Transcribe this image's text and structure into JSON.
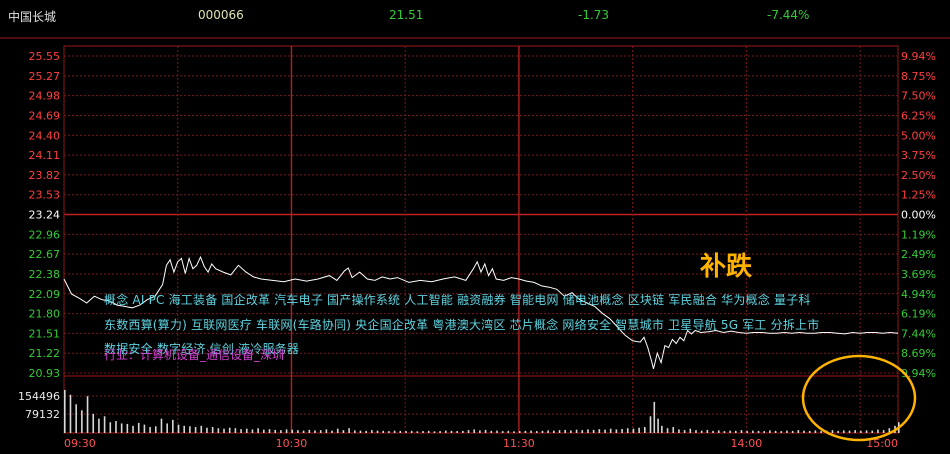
{
  "header": {
    "name": "中国长城",
    "code": "000066",
    "price": "21.51",
    "change": "-1.73",
    "pct": "-7.44%"
  },
  "colors": {
    "background": "#000000",
    "grid": "#7a1a1a",
    "axis": "#a01818",
    "up": "#ff4040",
    "down": "#33cc33",
    "neutral": "#ffffff",
    "price_line": "#ffffff",
    "volume": "#d8d8d8",
    "concept_text": "#5fd3e0",
    "sector_text": "#d040d0",
    "annotation": "#ffb300"
  },
  "concepts": {
    "line1": "概念  AI PC  海工装备  国企改革  汽车电子  国产操作系统  人工智能  融资融券  智能电网  储电池概念  区块链  军民融合  华为概念  量子科",
    "line2": "东数西算(算力)  互联网医疗  车联网(车路协同)  央企国企改革  粤港澳大湾区  芯片概念  网络安全  智慧城市  卫星导航  5G  军工  分拆上市",
    "line3": "数据安全  数字经济  信创  液冷服务器",
    "sector": "行业：计算机设备_通信设备_深圳"
  },
  "annotation": "补跌",
  "chart_data": {
    "type": "line",
    "title": "中国长城 000066 分时",
    "prev_close": 23.24,
    "ylim": [
      20.93,
      25.55
    ],
    "price_ticks": [
      "25.55",
      "25.27",
      "24.98",
      "24.69",
      "24.40",
      "24.11",
      "23.82",
      "23.53",
      "23.24",
      "22.96",
      "22.67",
      "22.38",
      "22.09",
      "21.80",
      "21.51",
      "21.22",
      "20.93"
    ],
    "pct_ticks": [
      "9.94%",
      "8.75%",
      "7.50%",
      "6.25%",
      "5.00%",
      "3.75%",
      "2.50%",
      "1.25%",
      "0.00%",
      "1.19%",
      "2.49%",
      "3.69%",
      "4.94%",
      "6.19%",
      "7.44%",
      "8.69%",
      "9.94%"
    ],
    "volume_ticks": [
      "154496",
      "79132"
    ],
    "vol_max": 230000,
    "time_labels": [
      "09:30",
      "10:30",
      "11:30",
      "14:00",
      "15:00"
    ],
    "price_series": [
      {
        "t": 0,
        "v": 22.3
      },
      {
        "t": 4,
        "v": 22.08
      },
      {
        "t": 8,
        "v": 22.02
      },
      {
        "t": 12,
        "v": 21.95
      },
      {
        "t": 16,
        "v": 22.05
      },
      {
        "t": 20,
        "v": 22.0
      },
      {
        "t": 24,
        "v": 21.98
      },
      {
        "t": 28,
        "v": 21.92
      },
      {
        "t": 32,
        "v": 21.9
      },
      {
        "t": 36,
        "v": 21.88
      },
      {
        "t": 40,
        "v": 21.92
      },
      {
        "t": 44,
        "v": 22.0
      },
      {
        "t": 48,
        "v": 22.05
      },
      {
        "t": 52,
        "v": 22.22
      },
      {
        "t": 54,
        "v": 22.5
      },
      {
        "t": 56,
        "v": 22.58
      },
      {
        "t": 58,
        "v": 22.4
      },
      {
        "t": 60,
        "v": 22.55
      },
      {
        "t": 62,
        "v": 22.6
      },
      {
        "t": 64,
        "v": 22.38
      },
      {
        "t": 66,
        "v": 22.6
      },
      {
        "t": 68,
        "v": 22.45
      },
      {
        "t": 70,
        "v": 22.5
      },
      {
        "t": 72,
        "v": 22.62
      },
      {
        "t": 74,
        "v": 22.48
      },
      {
        "t": 76,
        "v": 22.4
      },
      {
        "t": 78,
        "v": 22.52
      },
      {
        "t": 80,
        "v": 22.45
      },
      {
        "t": 84,
        "v": 22.4
      },
      {
        "t": 88,
        "v": 22.36
      },
      {
        "t": 92,
        "v": 22.5
      },
      {
        "t": 96,
        "v": 22.4
      },
      {
        "t": 100,
        "v": 22.33
      },
      {
        "t": 104,
        "v": 22.3
      },
      {
        "t": 110,
        "v": 22.28
      },
      {
        "t": 116,
        "v": 22.26
      },
      {
        "t": 122,
        "v": 22.3
      },
      {
        "t": 128,
        "v": 22.27
      },
      {
        "t": 134,
        "v": 22.3
      },
      {
        "t": 140,
        "v": 22.35
      },
      {
        "t": 144,
        "v": 22.28
      },
      {
        "t": 148,
        "v": 22.42
      },
      {
        "t": 150,
        "v": 22.46
      },
      {
        "t": 152,
        "v": 22.32
      },
      {
        "t": 156,
        "v": 22.4
      },
      {
        "t": 160,
        "v": 22.3
      },
      {
        "t": 164,
        "v": 22.28
      },
      {
        "t": 168,
        "v": 22.33
      },
      {
        "t": 172,
        "v": 22.3
      },
      {
        "t": 176,
        "v": 22.32
      },
      {
        "t": 182,
        "v": 22.25
      },
      {
        "t": 188,
        "v": 22.28
      },
      {
        "t": 194,
        "v": 22.26
      },
      {
        "t": 200,
        "v": 22.3
      },
      {
        "t": 206,
        "v": 22.33
      },
      {
        "t": 212,
        "v": 22.28
      },
      {
        "t": 216,
        "v": 22.45
      },
      {
        "t": 218,
        "v": 22.55
      },
      {
        "t": 220,
        "v": 22.4
      },
      {
        "t": 222,
        "v": 22.52
      },
      {
        "t": 224,
        "v": 22.35
      },
      {
        "t": 226,
        "v": 22.45
      },
      {
        "t": 228,
        "v": 22.3
      },
      {
        "t": 232,
        "v": 22.28
      },
      {
        "t": 236,
        "v": 22.32
      },
      {
        "t": 240,
        "v": 22.3
      },
      {
        "t": 244,
        "v": 22.27
      },
      {
        "t": 248,
        "v": 22.25
      },
      {
        "t": 252,
        "v": 22.2
      },
      {
        "t": 256,
        "v": 22.18
      },
      {
        "t": 260,
        "v": 22.15
      },
      {
        "t": 264,
        "v": 22.05
      },
      {
        "t": 268,
        "v": 22.1
      },
      {
        "t": 272,
        "v": 22.0
      },
      {
        "t": 276,
        "v": 21.95
      },
      {
        "t": 280,
        "v": 21.9
      },
      {
        "t": 284,
        "v": 21.8
      },
      {
        "t": 288,
        "v": 21.72
      },
      {
        "t": 292,
        "v": 21.6
      },
      {
        "t": 296,
        "v": 21.48
      },
      {
        "t": 300,
        "v": 21.4
      },
      {
        "t": 304,
        "v": 21.38
      },
      {
        "t": 306,
        "v": 21.45
      },
      {
        "t": 308,
        "v": 21.3
      },
      {
        "t": 310,
        "v": 21.1
      },
      {
        "t": 311,
        "v": 20.99
      },
      {
        "t": 313,
        "v": 21.22
      },
      {
        "t": 315,
        "v": 21.08
      },
      {
        "t": 317,
        "v": 21.33
      },
      {
        "t": 319,
        "v": 21.3
      },
      {
        "t": 321,
        "v": 21.42
      },
      {
        "t": 323,
        "v": 21.36
      },
      {
        "t": 325,
        "v": 21.45
      },
      {
        "t": 327,
        "v": 21.4
      },
      {
        "t": 329,
        "v": 21.55
      },
      {
        "t": 331,
        "v": 21.5
      },
      {
        "t": 333,
        "v": 21.55
      },
      {
        "t": 336,
        "v": 21.52
      },
      {
        "t": 340,
        "v": 21.53
      },
      {
        "t": 344,
        "v": 21.55
      },
      {
        "t": 348,
        "v": 21.52
      },
      {
        "t": 352,
        "v": 21.54
      },
      {
        "t": 356,
        "v": 21.52
      },
      {
        "t": 360,
        "v": 21.51
      },
      {
        "t": 364,
        "v": 21.52
      },
      {
        "t": 368,
        "v": 21.52
      },
      {
        "t": 372,
        "v": 21.51
      },
      {
        "t": 376,
        "v": 21.51
      },
      {
        "t": 380,
        "v": 21.52
      },
      {
        "t": 384,
        "v": 21.51
      },
      {
        "t": 388,
        "v": 21.52
      },
      {
        "t": 392,
        "v": 21.51
      },
      {
        "t": 396,
        "v": 21.51
      },
      {
        "t": 400,
        "v": 21.52
      },
      {
        "t": 404,
        "v": 21.52
      },
      {
        "t": 408,
        "v": 21.51
      },
      {
        "t": 412,
        "v": 21.5
      },
      {
        "t": 416,
        "v": 21.52
      },
      {
        "t": 420,
        "v": 21.51
      },
      {
        "t": 424,
        "v": 21.52
      },
      {
        "t": 428,
        "v": 21.52
      },
      {
        "t": 432,
        "v": 21.51
      },
      {
        "t": 436,
        "v": 21.52
      },
      {
        "t": 440,
        "v": 21.51
      }
    ],
    "volume_series": [
      {
        "t": 0,
        "v": 180000
      },
      {
        "t": 3,
        "v": 160000
      },
      {
        "t": 6,
        "v": 120000
      },
      {
        "t": 9,
        "v": 95000
      },
      {
        "t": 12,
        "v": 154000
      },
      {
        "t": 15,
        "v": 80000
      },
      {
        "t": 18,
        "v": 60000
      },
      {
        "t": 21,
        "v": 70000
      },
      {
        "t": 24,
        "v": 45000
      },
      {
        "t": 27,
        "v": 50000
      },
      {
        "t": 30,
        "v": 40000
      },
      {
        "t": 33,
        "v": 38000
      },
      {
        "t": 36,
        "v": 30000
      },
      {
        "t": 39,
        "v": 42000
      },
      {
        "t": 42,
        "v": 35000
      },
      {
        "t": 45,
        "v": 25000
      },
      {
        "t": 48,
        "v": 28000
      },
      {
        "t": 51,
        "v": 60000
      },
      {
        "t": 54,
        "v": 40000
      },
      {
        "t": 57,
        "v": 55000
      },
      {
        "t": 60,
        "v": 35000
      },
      {
        "t": 63,
        "v": 30000
      },
      {
        "t": 66,
        "v": 28000
      },
      {
        "t": 69,
        "v": 25000
      },
      {
        "t": 72,
        "v": 30000
      },
      {
        "t": 75,
        "v": 22000
      },
      {
        "t": 78,
        "v": 25000
      },
      {
        "t": 81,
        "v": 20000
      },
      {
        "t": 84,
        "v": 18000
      },
      {
        "t": 87,
        "v": 22000
      },
      {
        "t": 90,
        "v": 20000
      },
      {
        "t": 93,
        "v": 16000
      },
      {
        "t": 96,
        "v": 18000
      },
      {
        "t": 99,
        "v": 15000
      },
      {
        "t": 102,
        "v": 20000
      },
      {
        "t": 105,
        "v": 14000
      },
      {
        "t": 108,
        "v": 16000
      },
      {
        "t": 111,
        "v": 13000
      },
      {
        "t": 114,
        "v": 12000
      },
      {
        "t": 117,
        "v": 15000
      },
      {
        "t": 120,
        "v": 14000
      },
      {
        "t": 123,
        "v": 12000
      },
      {
        "t": 126,
        "v": 10000
      },
      {
        "t": 129,
        "v": 13000
      },
      {
        "t": 132,
        "v": 11000
      },
      {
        "t": 135,
        "v": 12000
      },
      {
        "t": 138,
        "v": 15000
      },
      {
        "t": 141,
        "v": 10000
      },
      {
        "t": 144,
        "v": 18000
      },
      {
        "t": 147,
        "v": 12000
      },
      {
        "t": 150,
        "v": 20000
      },
      {
        "t": 153,
        "v": 11000
      },
      {
        "t": 156,
        "v": 10000
      },
      {
        "t": 159,
        "v": 9000
      },
      {
        "t": 162,
        "v": 12000
      },
      {
        "t": 165,
        "v": 10000
      },
      {
        "t": 168,
        "v": 9000
      },
      {
        "t": 171,
        "v": 8000
      },
      {
        "t": 174,
        "v": 10000
      },
      {
        "t": 177,
        "v": 9000
      },
      {
        "t": 180,
        "v": 8000
      },
      {
        "t": 183,
        "v": 9000
      },
      {
        "t": 186,
        "v": 7000
      },
      {
        "t": 189,
        "v": 8000
      },
      {
        "t": 192,
        "v": 9000
      },
      {
        "t": 195,
        "v": 7000
      },
      {
        "t": 198,
        "v": 8000
      },
      {
        "t": 201,
        "v": 10000
      },
      {
        "t": 204,
        "v": 9000
      },
      {
        "t": 207,
        "v": 8000
      },
      {
        "t": 210,
        "v": 9000
      },
      {
        "t": 213,
        "v": 12000
      },
      {
        "t": 216,
        "v": 15000
      },
      {
        "t": 219,
        "v": 11000
      },
      {
        "t": 222,
        "v": 13000
      },
      {
        "t": 225,
        "v": 9000
      },
      {
        "t": 228,
        "v": 10000
      },
      {
        "t": 231,
        "v": 8000
      },
      {
        "t": 234,
        "v": 9000
      },
      {
        "t": 237,
        "v": 7000
      },
      {
        "t": 240,
        "v": 8000
      },
      {
        "t": 243,
        "v": 9000
      },
      {
        "t": 246,
        "v": 10000
      },
      {
        "t": 249,
        "v": 8000
      },
      {
        "t": 252,
        "v": 9000
      },
      {
        "t": 255,
        "v": 11000
      },
      {
        "t": 258,
        "v": 10000
      },
      {
        "t": 261,
        "v": 12000
      },
      {
        "t": 264,
        "v": 13000
      },
      {
        "t": 267,
        "v": 11000
      },
      {
        "t": 270,
        "v": 14000
      },
      {
        "t": 273,
        "v": 12000
      },
      {
        "t": 276,
        "v": 15000
      },
      {
        "t": 279,
        "v": 13000
      },
      {
        "t": 282,
        "v": 16000
      },
      {
        "t": 285,
        "v": 14000
      },
      {
        "t": 288,
        "v": 18000
      },
      {
        "t": 291,
        "v": 15000
      },
      {
        "t": 294,
        "v": 17000
      },
      {
        "t": 297,
        "v": 20000
      },
      {
        "t": 300,
        "v": 18000
      },
      {
        "t": 303,
        "v": 22000
      },
      {
        "t": 306,
        "v": 25000
      },
      {
        "t": 309,
        "v": 70000
      },
      {
        "t": 311,
        "v": 130000
      },
      {
        "t": 313,
        "v": 60000
      },
      {
        "t": 315,
        "v": 30000
      },
      {
        "t": 318,
        "v": 20000
      },
      {
        "t": 321,
        "v": 25000
      },
      {
        "t": 324,
        "v": 15000
      },
      {
        "t": 327,
        "v": 12000
      },
      {
        "t": 330,
        "v": 18000
      },
      {
        "t": 333,
        "v": 12000
      },
      {
        "t": 336,
        "v": 10000
      },
      {
        "t": 339,
        "v": 13000
      },
      {
        "t": 342,
        "v": 9000
      },
      {
        "t": 345,
        "v": 11000
      },
      {
        "t": 348,
        "v": 8000
      },
      {
        "t": 351,
        "v": 10000
      },
      {
        "t": 354,
        "v": 9000
      },
      {
        "t": 357,
        "v": 12000
      },
      {
        "t": 360,
        "v": 8000
      },
      {
        "t": 363,
        "v": 10000
      },
      {
        "t": 366,
        "v": 9000
      },
      {
        "t": 369,
        "v": 8000
      },
      {
        "t": 372,
        "v": 11000
      },
      {
        "t": 375,
        "v": 9000
      },
      {
        "t": 378,
        "v": 8000
      },
      {
        "t": 381,
        "v": 10000
      },
      {
        "t": 384,
        "v": 9000
      },
      {
        "t": 387,
        "v": 12000
      },
      {
        "t": 390,
        "v": 10000
      },
      {
        "t": 393,
        "v": 9000
      },
      {
        "t": 396,
        "v": 11000
      },
      {
        "t": 399,
        "v": 8000
      },
      {
        "t": 402,
        "v": 10000
      },
      {
        "t": 405,
        "v": 12000
      },
      {
        "t": 408,
        "v": 9000
      },
      {
        "t": 411,
        "v": 11000
      },
      {
        "t": 414,
        "v": 10000
      },
      {
        "t": 417,
        "v": 12000
      },
      {
        "t": 420,
        "v": 9000
      },
      {
        "t": 423,
        "v": 11000
      },
      {
        "t": 426,
        "v": 10000
      },
      {
        "t": 429,
        "v": 14000
      },
      {
        "t": 432,
        "v": 12000
      },
      {
        "t": 435,
        "v": 20000
      },
      {
        "t": 438,
        "v": 30000
      },
      {
        "t": 440,
        "v": 45000
      }
    ],
    "time_range": [
      0,
      440
    ],
    "grid": true,
    "highlight": {
      "t_range": [
        300,
        350
      ],
      "note": "补跌"
    }
  }
}
